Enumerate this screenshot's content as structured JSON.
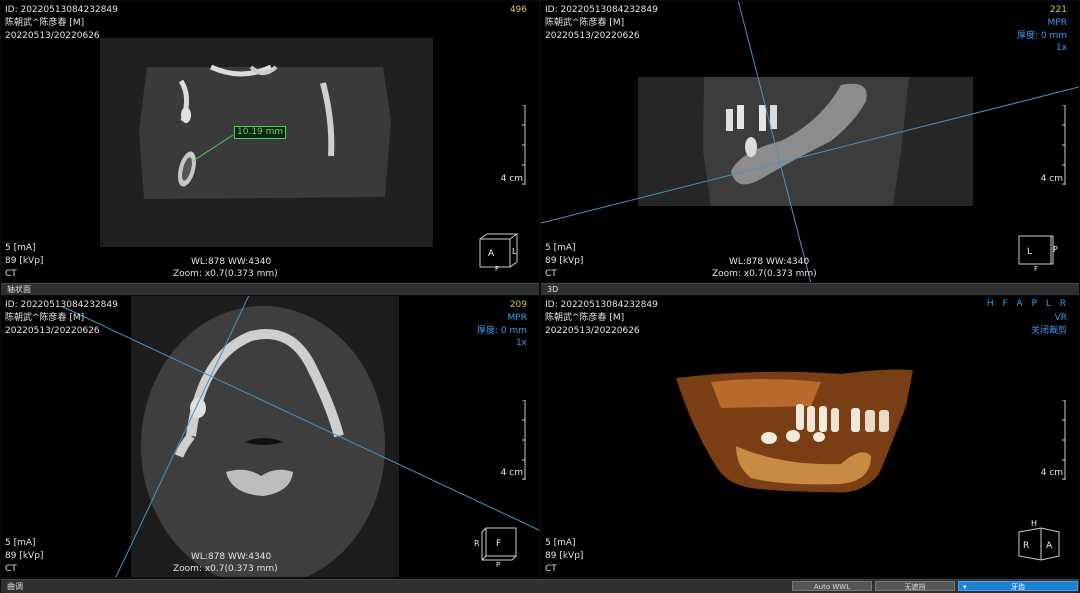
{
  "viewports": {
    "tl": {
      "id": "ID: 202205130842328​49",
      "name": "陈朝武^陈彦春  [M]",
      "dates": "20220513/20220626",
      "slice": "496",
      "mode": "",
      "thickness": "",
      "zoomfactor": "",
      "measurement": "10.19 mm",
      "scale": "4 cm",
      "ma": "5 [mA]",
      "kvp": "89 [kVp]",
      "modality": "CT",
      "wl": "WL:878 WW:4340",
      "zoom": "Zoom: x0.7(0.373 mm)",
      "cube": {
        "face": "A",
        "side": "L",
        "bottom": "F"
      }
    },
    "tr": {
      "id": "ID: 20220513084232849",
      "name": "陈朝武^陈彦春  [M]",
      "dates": "20220513/20220626",
      "slice": "221",
      "mode": "MPR",
      "thickness": "厚度: 0 mm",
      "zoomfactor": "1x",
      "scale": "4 cm",
      "ma": "5 [mA]",
      "kvp": "89 [kVp]",
      "modality": "CT",
      "wl": "WL:878 WW:4340",
      "zoom": "Zoom: x0.7(0.373 mm)",
      "cube": {
        "face": "L",
        "side": "P",
        "bottom": "F"
      }
    },
    "bl": {
      "id": "ID: 20220513084232849",
      "name": "陈朝武^陈彦春  [M]",
      "dates": "20220513/20220626",
      "slice": "209",
      "mode": "MPR",
      "thickness": "厚度: 0 mm",
      "zoomfactor": "1x",
      "scale": "4 cm",
      "ma": "5 [mA]",
      "kvp": "89 [kVp]",
      "modality": "CT",
      "wl": "WL:878 WW:4340",
      "zoom": "Zoom: x0.7(0.373 mm)",
      "cube": {
        "face": "F",
        "side": "R",
        "bottom": "P"
      }
    },
    "br": {
      "id": "ID: 20220513084232849",
      "name": "陈朝武^陈彦春  [M]",
      "dates": "20220513/20220626",
      "orient": "H F A P L R",
      "mode": "VR",
      "clip": "关闭裁剪",
      "scale": "4 cm",
      "ma": "5 [mA]",
      "kvp": "89 [kVp]",
      "modality": "CT",
      "cube": {
        "face": "A",
        "side": "R",
        "top": "H"
      }
    }
  },
  "labels": {
    "axial": "轴状面",
    "three_d": "3D",
    "bottom": "曲调"
  },
  "buttons": {
    "auto_wwl": "Auto WWL",
    "no_mask": "无遮挡",
    "teeth": "牙齿"
  },
  "colors": {
    "accent": "#1d7fd6",
    "overlay_text": "#3c9be8",
    "slice_number": "#d8c84a",
    "measurement": "#42d65a"
  }
}
